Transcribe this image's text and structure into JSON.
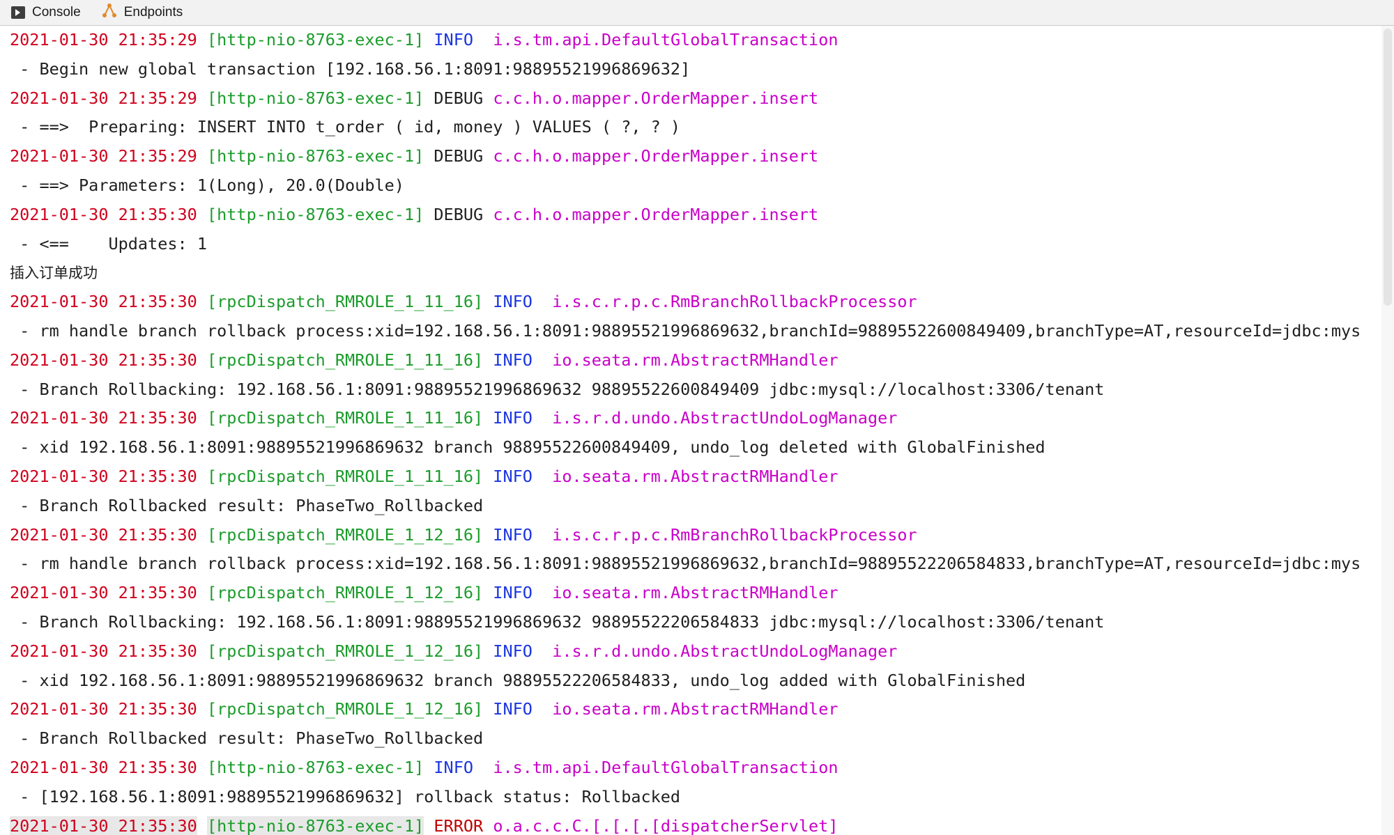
{
  "tabs": [
    {
      "label": "Console",
      "icon": "console-icon",
      "active": true
    },
    {
      "label": "Endpoints",
      "icon": "endpoints-icon",
      "active": false
    }
  ],
  "colors": {
    "timestamp": "#d0001c",
    "thread": "#1a9c2a",
    "info": "#1a35e0",
    "error": "#c00000",
    "logger": "#c800c8",
    "text": "#1f1f1f"
  },
  "log": [
    {
      "ts": "2021-01-30 21:35:29",
      "thread": "[http-nio-8763-exec-1]",
      "level": "INFO ",
      "logger": "i.s.tm.api.DefaultGlobalTransaction"
    },
    {
      "msg": " - Begin new global transaction [192.168.56.1:8091:98895521996869632]"
    },
    {
      "ts": "2021-01-30 21:35:29",
      "thread": "[http-nio-8763-exec-1]",
      "level": "DEBUG",
      "logger": "c.c.h.o.mapper.OrderMapper.insert"
    },
    {
      "msg": " - ==>  Preparing: INSERT INTO t_order ( id, money ) VALUES ( ?, ? )"
    },
    {
      "ts": "2021-01-30 21:35:29",
      "thread": "[http-nio-8763-exec-1]",
      "level": "DEBUG",
      "logger": "c.c.h.o.mapper.OrderMapper.insert"
    },
    {
      "msg": " - ==> Parameters: 1(Long), 20.0(Double)"
    },
    {
      "ts": "2021-01-30 21:35:30",
      "thread": "[http-nio-8763-exec-1]",
      "level": "DEBUG",
      "logger": "c.c.h.o.mapper.OrderMapper.insert"
    },
    {
      "msg": " - <==    Updates: 1"
    },
    {
      "msg": "插入订单成功"
    },
    {
      "ts": "2021-01-30 21:35:30",
      "thread": "[rpcDispatch_RMROLE_1_11_16]",
      "level": "INFO ",
      "logger": "i.s.c.r.p.c.RmBranchRollbackProcessor"
    },
    {
      "msg": " - rm handle branch rollback process:xid=192.168.56.1:8091:98895521996869632,branchId=98895522600849409,branchType=AT,resourceId=jdbc:mys"
    },
    {
      "ts": "2021-01-30 21:35:30",
      "thread": "[rpcDispatch_RMROLE_1_11_16]",
      "level": "INFO ",
      "logger": "io.seata.rm.AbstractRMHandler"
    },
    {
      "msg": " - Branch Rollbacking: 192.168.56.1:8091:98895521996869632 98895522600849409 jdbc:mysql://localhost:3306/tenant"
    },
    {
      "ts": "2021-01-30 21:35:30",
      "thread": "[rpcDispatch_RMROLE_1_11_16]",
      "level": "INFO ",
      "logger": "i.s.r.d.undo.AbstractUndoLogManager"
    },
    {
      "msg": " - xid 192.168.56.1:8091:98895521996869632 branch 98895522600849409, undo_log deleted with GlobalFinished"
    },
    {
      "ts": "2021-01-30 21:35:30",
      "thread": "[rpcDispatch_RMROLE_1_11_16]",
      "level": "INFO ",
      "logger": "io.seata.rm.AbstractRMHandler"
    },
    {
      "msg": " - Branch Rollbacked result: PhaseTwo_Rollbacked"
    },
    {
      "ts": "2021-01-30 21:35:30",
      "thread": "[rpcDispatch_RMROLE_1_12_16]",
      "level": "INFO ",
      "logger": "i.s.c.r.p.c.RmBranchRollbackProcessor"
    },
    {
      "msg": " - rm handle branch rollback process:xid=192.168.56.1:8091:98895521996869632,branchId=98895522206584833,branchType=AT,resourceId=jdbc:mys"
    },
    {
      "ts": "2021-01-30 21:35:30",
      "thread": "[rpcDispatch_RMROLE_1_12_16]",
      "level": "INFO ",
      "logger": "io.seata.rm.AbstractRMHandler"
    },
    {
      "msg": " - Branch Rollbacking: 192.168.56.1:8091:98895521996869632 98895522206584833 jdbc:mysql://localhost:3306/tenant"
    },
    {
      "ts": "2021-01-30 21:35:30",
      "thread": "[rpcDispatch_RMROLE_1_12_16]",
      "level": "INFO ",
      "logger": "i.s.r.d.undo.AbstractUndoLogManager"
    },
    {
      "msg": " - xid 192.168.56.1:8091:98895521996869632 branch 98895522206584833, undo_log added with GlobalFinished"
    },
    {
      "ts": "2021-01-30 21:35:30",
      "thread": "[rpcDispatch_RMROLE_1_12_16]",
      "level": "INFO ",
      "logger": "io.seata.rm.AbstractRMHandler"
    },
    {
      "msg": " - Branch Rollbacked result: PhaseTwo_Rollbacked"
    },
    {
      "ts": "2021-01-30 21:35:30",
      "thread": "[http-nio-8763-exec-1]",
      "level": "INFO ",
      "logger": "i.s.tm.api.DefaultGlobalTransaction"
    },
    {
      "msg": " - [192.168.56.1:8091:98895521996869632] rollback status: Rollbacked"
    },
    {
      "ts": "2021-01-30 21:35:30",
      "thread": "[http-nio-8763-exec-1]",
      "level": "ERROR",
      "logger": "o.a.c.c.C.[.[.[.[dispatcherServlet]"
    }
  ]
}
